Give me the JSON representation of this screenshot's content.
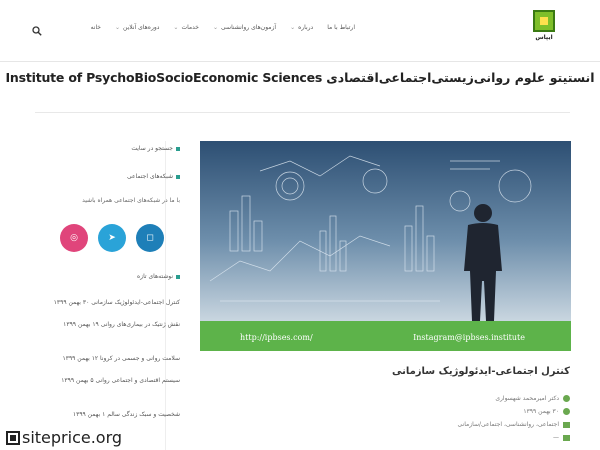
{
  "nav": {
    "items": [
      {
        "label": "خانه",
        "has_submenu": false
      },
      {
        "label": "دوره‌های آنلاین",
        "has_submenu": true
      },
      {
        "label": "خدمات",
        "has_submenu": true
      },
      {
        "label": "آزمون‌های روانشناسی",
        "has_submenu": true
      },
      {
        "label": "درباره",
        "has_submenu": true
      },
      {
        "label": "ارتباط با ما",
        "has_submenu": false
      }
    ],
    "search_icon": "search-icon"
  },
  "logo": {
    "text": "ایپاس"
  },
  "site": {
    "title": "Institute of PsychoBioSocioEconomic Sciences انستیتو علوم روانی‌زیستی‌اجتماعی‌اقتصادی"
  },
  "hero": {
    "url_text": "http://ipbses.com/",
    "instagram_text": "Instagram@ipbses.institute"
  },
  "post": {
    "title": "کنترل اجتماعی-ایدئولوژیک سازمانی",
    "author": "دکتر امیرمحمد شهسواری",
    "date": "۳۰ بهمن ۱۳۹۹",
    "categories": "اجتماعی، روانشناسی، اجتماعی/سازمانی",
    "tags": "—"
  },
  "sidebar": {
    "search_label": "جستجو در سایت",
    "social_heading": "شبکه‌های اجتماعی",
    "social_text": "با ما در شبکه‌های اجتماعی همراه باشید",
    "recent_heading": "نوشته‌های تازه",
    "recent_posts": [
      "کنترل اجتماعی-ایدئولوژیک سازمانی ۳۰ بهمن ۱۳۹۹",
      "نقش ژنتیک در بیماری‌های روانی ۱۹ بهمن ۱۳۹۹",
      "سلامت روانی و جسمی در کرونا ۱۲ بهمن ۱۳۹۹",
      "سیستم اقتصادی و اجتماعی روانی ۵ بهمن ۱۳۹۹",
      "شخصیت و سبک زندگی سالم ۱ بهمن ۱۳۹۹"
    ],
    "social_icons": [
      "instagram-icon",
      "telegram-icon",
      "website-icon"
    ]
  },
  "watermark": {
    "text": "siteprice.org"
  },
  "colors": {
    "green": "#5db34a",
    "instagram": "#1e7fb8",
    "telegram": "#2aa3d8",
    "web": "#e0457b"
  }
}
